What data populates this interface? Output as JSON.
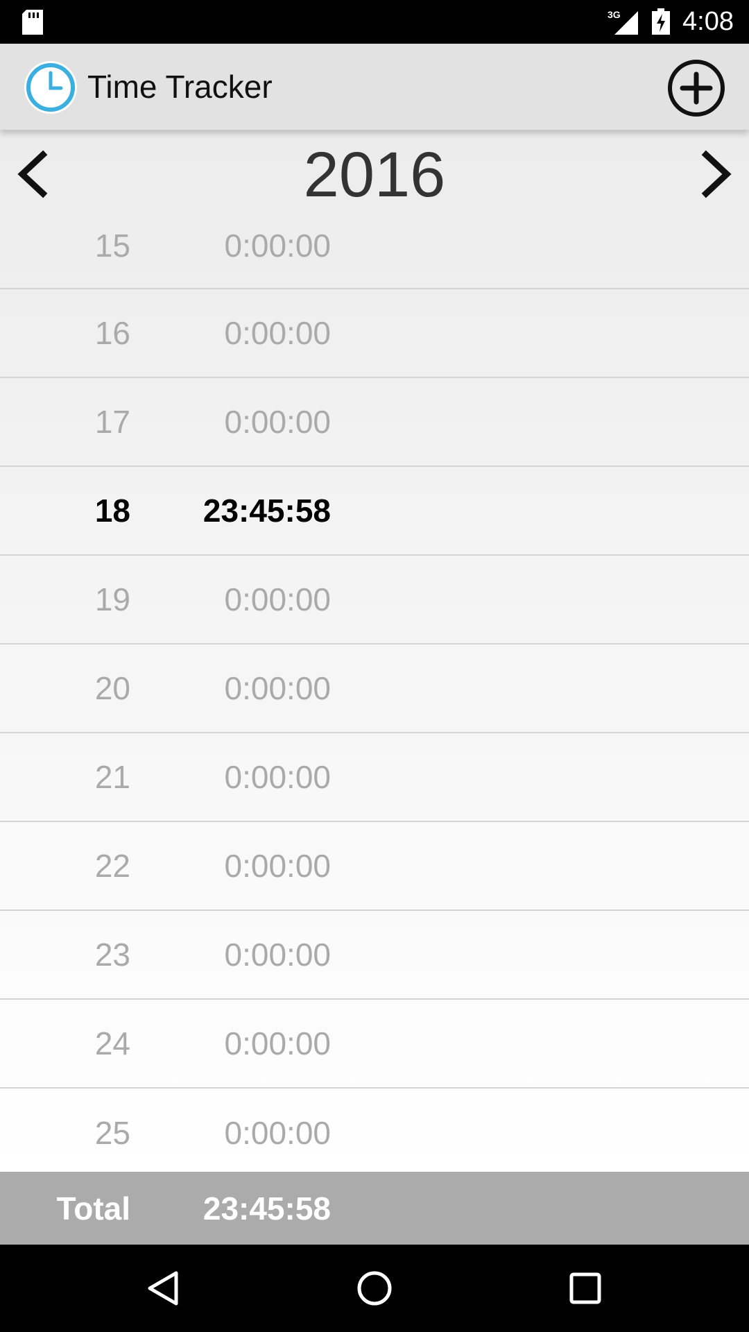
{
  "status_bar": {
    "network": "3G",
    "time": "4:08"
  },
  "app_bar": {
    "title": "Time Tracker",
    "add_icon": "add-circle-icon"
  },
  "year_header": {
    "year": "2016",
    "prev_icon": "chevron-left-icon",
    "next_icon": "chevron-right-icon"
  },
  "days": [
    {
      "day": "15",
      "time": "0:00:00"
    },
    {
      "day": "16",
      "time": "0:00:00"
    },
    {
      "day": "17",
      "time": "0:00:00"
    },
    {
      "day": "18",
      "time": "23:45:58",
      "selected": true
    },
    {
      "day": "19",
      "time": "0:00:00"
    },
    {
      "day": "20",
      "time": "0:00:00"
    },
    {
      "day": "21",
      "time": "0:00:00"
    },
    {
      "day": "22",
      "time": "0:00:00"
    },
    {
      "day": "23",
      "time": "0:00:00"
    },
    {
      "day": "24",
      "time": "0:00:00"
    },
    {
      "day": "25",
      "time": "0:00:00"
    }
  ],
  "total": {
    "label": "Total",
    "value": "23:45:58"
  },
  "colors": {
    "app_icon_accent": "#3bb0e0",
    "total_bar": "#ababab",
    "inactive_text": "#aaaaaa"
  }
}
